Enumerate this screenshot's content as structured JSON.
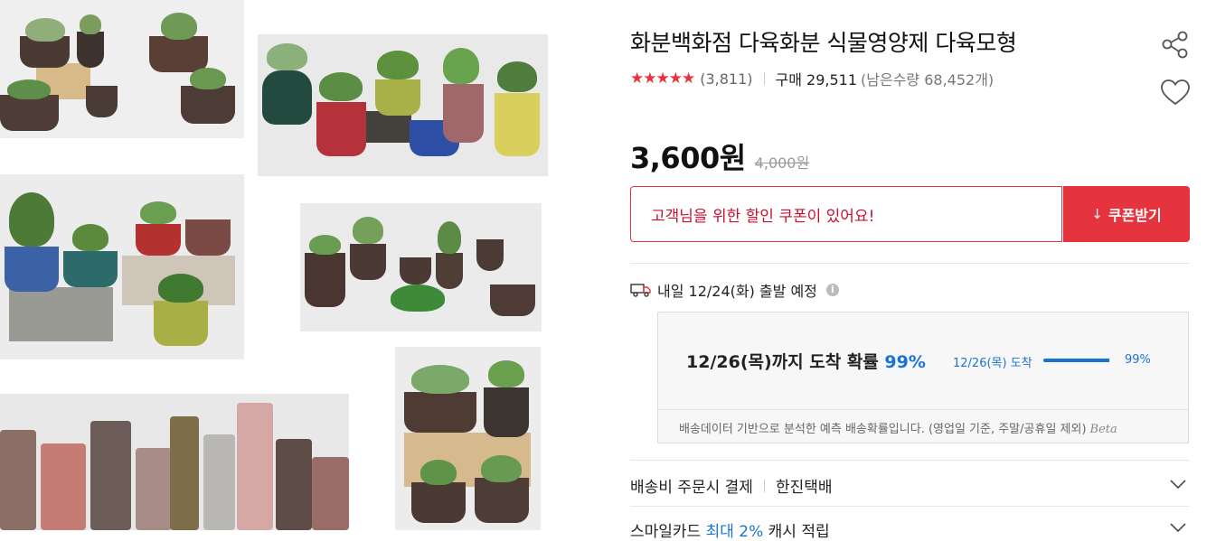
{
  "product": {
    "title": "화분백화점 다육화분 식물영양제 다육모형",
    "stars": "★★★★★",
    "rating_count": "(3,811)",
    "purchase": "구매 29,511",
    "remaining": "(남은수량 68,452개)",
    "price": "3,600원",
    "original_price": "4,000원"
  },
  "coupon": {
    "message": "고객님을 위한 할인 쿠폰이 있어요!",
    "button_label": "쿠폰받기",
    "button_icon": "↓"
  },
  "shipping": {
    "departure": "내일 12/24(화) 출발 예정",
    "info_icon": "i",
    "arrival_prefix": "12/26(목)까지 도착 확률 ",
    "arrival_pct": "99%",
    "bar_date_label": "12/26(목) 도착",
    "bar_value_label": "99%",
    "bar_fraction": 0.99,
    "note": "배송데이터 기반으로 분석한 예측 배송확률입니다. (영업일 기준, 주말/공휴일 제외)",
    "beta": "Beta"
  },
  "fee": {
    "label": "배송비 주문시 결제",
    "carrier": "한진택배"
  },
  "smilecard": {
    "prefix": "스마일카드 ",
    "highlight": "최대 2%",
    "suffix": " 캐시 적립"
  },
  "colors": {
    "accent": "#e5343d",
    "blue": "#1a73d4"
  }
}
